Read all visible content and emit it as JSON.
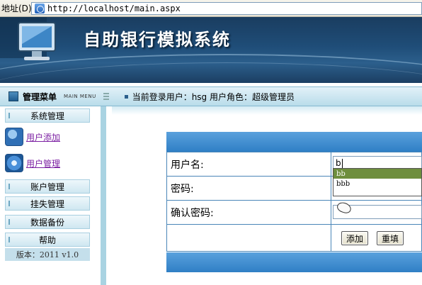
{
  "browser": {
    "address_label": "地址(D)",
    "url": "http://localhost/main.aspx"
  },
  "banner": {
    "title": "自助银行模拟系统"
  },
  "statusbar": {
    "menu_title": "管理菜单",
    "menu_subtitle": "MAIN MENU",
    "user_info": "当前登录用户：hsg   用户角色：超级管理员"
  },
  "sidebar": {
    "sections": [
      {
        "label": "系统管理"
      },
      {
        "label": "账户管理"
      },
      {
        "label": "挂失管理"
      },
      {
        "label": "数据备份"
      },
      {
        "label": "帮助"
      }
    ],
    "sub_items": [
      {
        "label": "用户添加",
        "icon": "user-add-icon"
      },
      {
        "label": "用户管理",
        "icon": "gear-icon"
      }
    ],
    "version": "版本：2011  v1.0"
  },
  "form": {
    "username_label": "用户名:",
    "password_label": "密码:",
    "confirm_label": "确认密码:",
    "username_value": "b",
    "autocomplete_options": [
      "bb",
      "bbb"
    ],
    "add_button": "添加",
    "reset_button": "重填"
  },
  "colors": {
    "banner": "#1f4d78",
    "form_header": "#3f8cd0",
    "sidebar_border": "#a9d3e2",
    "link": "#7b1fa2"
  }
}
